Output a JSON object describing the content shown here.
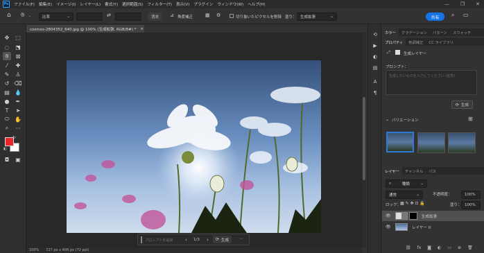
{
  "app": {
    "logo": "Ps"
  },
  "menu": [
    "ファイル(F)",
    "編集(E)",
    "イメージ(I)",
    "レイヤー(L)",
    "書式(Y)",
    "選択範囲(S)",
    "フィルター(T)",
    "表示(V)",
    "プラグイン",
    "ウィンドウ(W)",
    "ヘルプ(H)"
  ],
  "window_controls": [
    "—",
    "❐",
    "✕"
  ],
  "options": {
    "ratio": "比率",
    "clear_btn": "消去",
    "straighten": "角度補正",
    "delete_cropped": "切り抜いたピクセルを削除",
    "fill_label": "塗り：",
    "fill_value": "生成拡張",
    "share": "共有"
  },
  "document": {
    "tab_title": "cosmos-2804352_640.jpg @ 100% (生成拡張, RGB/8#) *",
    "close": "×"
  },
  "contextual_bar": {
    "prompt_placeholder": "プロンプトを追加",
    "prev": "‹",
    "page": "1/3",
    "next": "›",
    "generate": "生成",
    "more": "···"
  },
  "status": {
    "zoom": "100%",
    "dims": "727 px x 406 px (72 ppi)"
  },
  "panel_top_tabs": [
    "カラー",
    "グラデーション",
    "パターン",
    "スウォッチ"
  ],
  "properties": {
    "tabs": [
      "プロパティ",
      "色調補正",
      "CC ライブラリ"
    ],
    "layer_type": "生成レイヤー",
    "prompt_label": "プロンプト：",
    "prompt_placeholder": "生成したいものを入力してください (任意)",
    "generate_btn": "生成",
    "variations_label": "バリエーション"
  },
  "layers": {
    "tabs": [
      "レイヤー",
      "チャンネル",
      "パス"
    ],
    "filter": "種類",
    "blend_mode": "通常",
    "opacity_label": "不透明度：",
    "opacity": "100%",
    "lock_label": "ロック：",
    "fill_label": "塗り：",
    "fill": "100%",
    "items": [
      {
        "name": "生成拡張"
      },
      {
        "name": "レイヤー 0"
      }
    ]
  },
  "colors": {
    "foreground": "#e8262b",
    "background": "#ffffff",
    "accent": "#1473e6"
  }
}
